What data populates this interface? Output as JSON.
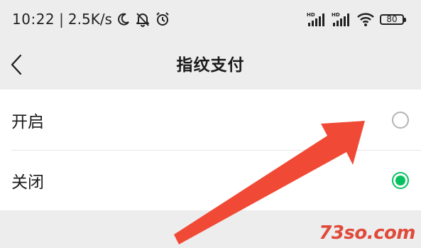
{
  "status_bar": {
    "time": "10:22",
    "separator": "|",
    "net_speed": "2.5K/s",
    "icons": [
      "moon-icon",
      "mute-icon",
      "alarm-icon",
      "hd-signal-icon",
      "hd-signal-icon",
      "wifi-icon",
      "battery-icon"
    ],
    "hd_label": "HD",
    "battery_level": "80"
  },
  "nav": {
    "back_icon": "chevron-left-icon",
    "title": "指纹支付"
  },
  "options": [
    {
      "label": "开启",
      "selected": false
    },
    {
      "label": "关闭",
      "selected": true
    }
  ],
  "colors": {
    "accent": "#07c160",
    "background": "#ededed",
    "arrow": "#f04a36",
    "watermark": "#e04a3a"
  },
  "watermark": "73so.com"
}
